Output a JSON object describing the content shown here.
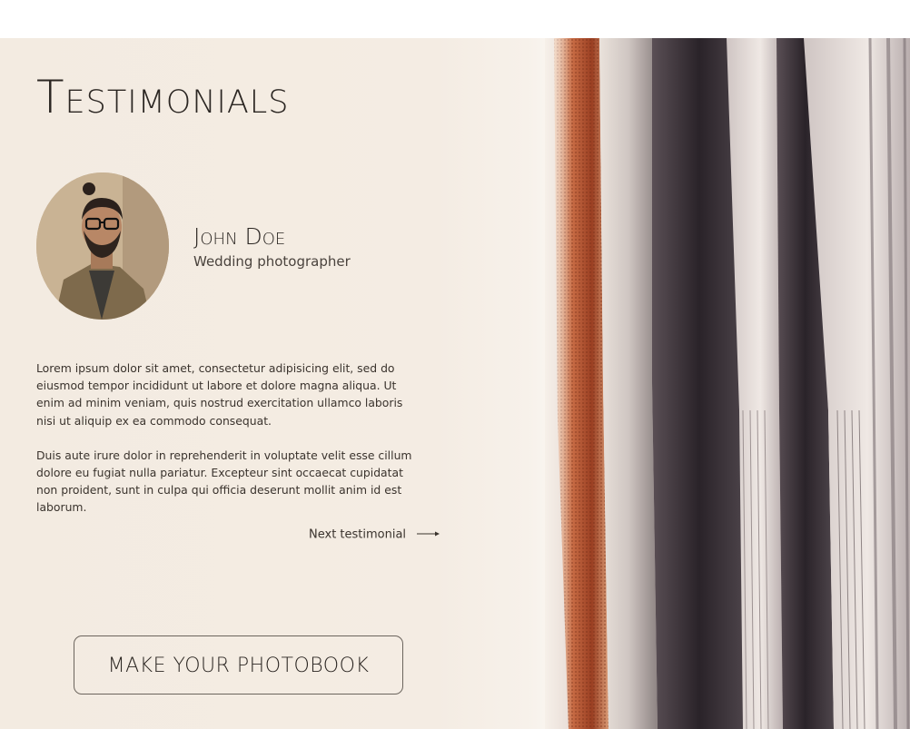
{
  "section": {
    "title": "Testimonials"
  },
  "testimonial": {
    "name": "John Doe",
    "role": "Wedding photographer",
    "paragraphs": [
      "Lorem ipsum dolor sit amet, consectetur adipisicing elit, sed do eiusmod tempor incididunt ut labore et dolore magna aliqua. Ut enim ad minim veniam, quis nostrud exercitation ullamco laboris nisi ut aliquip ex ea commodo consequat.",
      "Duis aute irure dolor in reprehenderit in voluptate velit esse cillum dolore eu fugiat nulla pariatur. Excepteur sint occaecat cupidatat non proident, sunt in culpa qui officia deserunt mollit anim id est laborum."
    ],
    "next_label": "Next testimonial",
    "next_icon": "arrow-right-icon"
  },
  "cta": {
    "label": "MAKE YOUR PHOTOBOOK"
  },
  "colors": {
    "background": "#f4ece3",
    "text": "#2b2622",
    "accent_copper": "#c0603a"
  }
}
